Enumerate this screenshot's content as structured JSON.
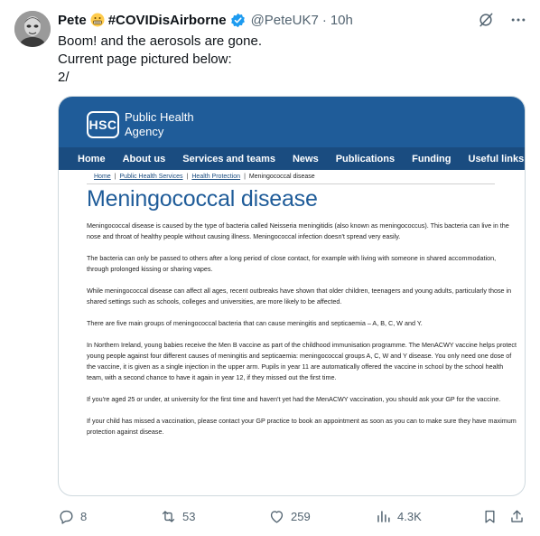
{
  "tweet": {
    "author_name": "Pete",
    "author_tag": "#COVIDisAirborne",
    "handle": "@PeteUK7",
    "separator": "·",
    "time": "10h",
    "lines": [
      "Boom! and the aerosols are gone.",
      "Current page pictured below:",
      "2/"
    ]
  },
  "card": {
    "logo": "HSC",
    "org_line1": "Public Health",
    "org_line2": "Agency",
    "nav": [
      "Home",
      "About us",
      "Services and teams",
      "News",
      "Publications",
      "Funding",
      "Useful links"
    ],
    "breadcrumb": [
      "Home",
      "Public Health Services",
      "Health Protection",
      "Meningococcal disease"
    ],
    "breadcrumb_sep": "|",
    "title": "Meningococcal disease",
    "paragraphs": [
      "Meningococcal disease is caused by the type of bacteria called Neisseria meningitidis (also known as meningococcus). This bacteria can live in the nose and throat of healthy people without causing illness. Meningococcal infection doesn't spread very easily.",
      "The bacteria can only be passed to others after a long period of close contact, for example with living with someone in shared accommodation, through prolonged kissing or sharing vapes.",
      "While meningococcal disease can affect all ages, recent outbreaks have shown that older children, teenagers and young adults, particularly those in shared settings such as schools, colleges and universities, are more likely to be affected.",
      "There are five main groups of meningococcal bacteria that can cause meningitis and septicaemia – A, B, C, W and Y.",
      "In Northern Ireland, young babies receive the Men B vaccine as part of the childhood immunisation programme. The MenACWY vaccine helps protect young people against four different causes of meningitis and septicaemia: meningococcal groups A, C, W and Y disease. You only need one dose of the vaccine, it is given as a single injection in the upper arm. Pupils in year 11 are automatically offered the vaccine in school by the school health team, with a second chance to have it again in year 12, if they missed out the first time.",
      "If you're aged 25 or under, at university for the first time and haven't yet had the MenACWY vaccination, you should ask your GP for the vaccine.",
      "If your child has missed a vaccination, please contact your GP practice to book an appointment as soon as you can to make sure they have maximum protection against disease."
    ]
  },
  "actions": {
    "replies": "8",
    "reposts": "53",
    "likes": "259",
    "views": "4.3K"
  },
  "icons": {
    "emoji": "grimacing-face-icon",
    "verified": "verified-badge-icon",
    "grok": "grok-icon",
    "more": "more-icon",
    "reply": "reply-icon",
    "repost": "repost-icon",
    "like": "like-icon",
    "views": "views-icon",
    "bookmark": "bookmark-icon",
    "share": "share-icon"
  },
  "colors": {
    "verified": "#1d9bf0",
    "brand_blue": "#1f5c99",
    "nav_blue": "#1a4c80",
    "secondary_text": "#536471"
  }
}
